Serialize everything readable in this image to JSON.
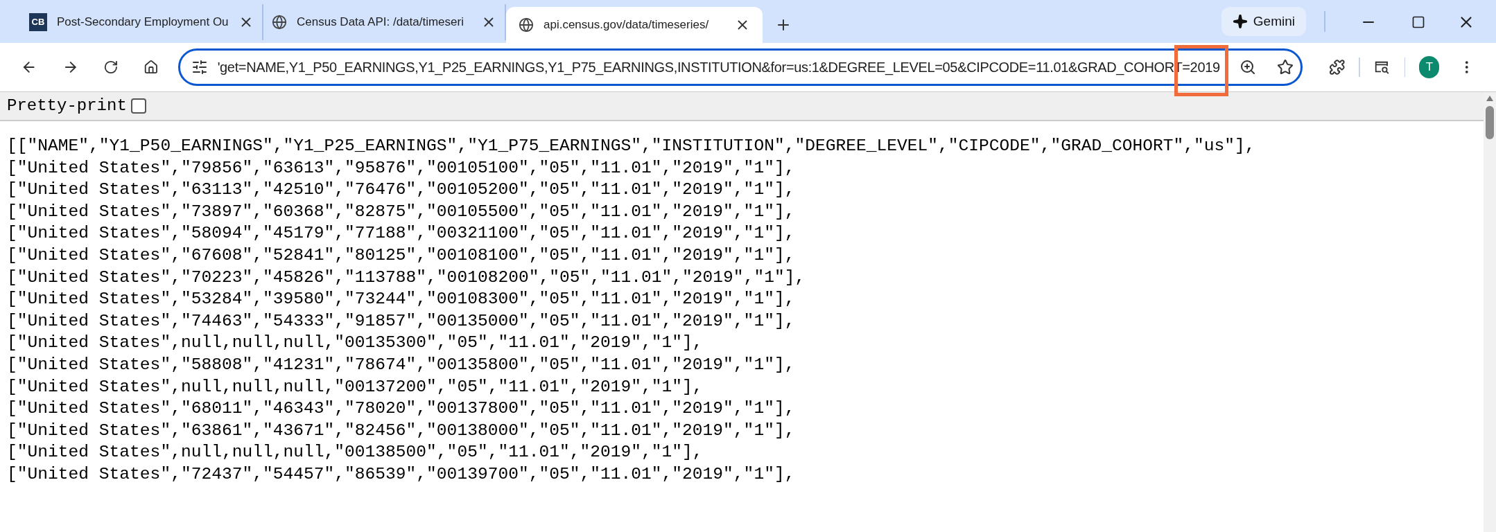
{
  "tabs": [
    {
      "kind": "logo",
      "logo_text": "CB",
      "label": "Post-Secondary Employment Ou",
      "selected": false
    },
    {
      "kind": "globe",
      "label": "Census Data API: /data/timeseri",
      "selected": false
    },
    {
      "kind": "globe",
      "label": "api.census.gov/data/timeseries/",
      "selected": true
    }
  ],
  "gemini_button": "Gemini",
  "address_bar": {
    "url": "'get=NAME,Y1_P50_EARNINGS,Y1_P25_EARNINGS,Y1_P75_EARNINGS,INSTITUTION&for=us:1&DEGREE_LEVEL=05&CIPCODE=11.01&GRAD_COHORT=2019",
    "highlighted": true
  },
  "profile": {
    "initial": "T"
  },
  "pretty_print": {
    "label": "Pretty-print",
    "checked": false
  },
  "lines": [
    "[[\"NAME\",\"Y1_P50_EARNINGS\",\"Y1_P25_EARNINGS\",\"Y1_P75_EARNINGS\",\"INSTITUTION\",\"DEGREE_LEVEL\",\"CIPCODE\",\"GRAD_COHORT\",\"us\"],",
    "[\"United States\",\"79856\",\"63613\",\"95876\",\"00105100\",\"05\",\"11.01\",\"2019\",\"1\"],",
    "[\"United States\",\"63113\",\"42510\",\"76476\",\"00105200\",\"05\",\"11.01\",\"2019\",\"1\"],",
    "[\"United States\",\"73897\",\"60368\",\"82875\",\"00105500\",\"05\",\"11.01\",\"2019\",\"1\"],",
    "[\"United States\",\"58094\",\"45179\",\"77188\",\"00321100\",\"05\",\"11.01\",\"2019\",\"1\"],",
    "[\"United States\",\"67608\",\"52841\",\"80125\",\"00108100\",\"05\",\"11.01\",\"2019\",\"1\"],",
    "[\"United States\",\"70223\",\"45826\",\"113788\",\"00108200\",\"05\",\"11.01\",\"2019\",\"1\"],",
    "[\"United States\",\"53284\",\"39580\",\"73244\",\"00108300\",\"05\",\"11.01\",\"2019\",\"1\"],",
    "[\"United States\",\"74463\",\"54333\",\"91857\",\"00135000\",\"05\",\"11.01\",\"2019\",\"1\"],",
    "[\"United States\",null,null,null,\"00135300\",\"05\",\"11.01\",\"2019\",\"1\"],",
    "[\"United States\",\"58808\",\"41231\",\"78674\",\"00135800\",\"05\",\"11.01\",\"2019\",\"1\"],",
    "[\"United States\",null,null,null,\"00137200\",\"05\",\"11.01\",\"2019\",\"1\"],",
    "[\"United States\",\"68011\",\"46343\",\"78020\",\"00137800\",\"05\",\"11.01\",\"2019\",\"1\"],",
    "[\"United States\",\"63861\",\"43671\",\"82456\",\"00138000\",\"05\",\"11.01\",\"2019\",\"1\"],",
    "[\"United States\",null,null,null,\"00138500\",\"05\",\"11.01\",\"2019\",\"1\"],",
    "[\"United States\",\"72437\",\"54457\",\"86539\",\"00139700\",\"05\",\"11.01\",\"2019\",\"1\"],"
  ]
}
